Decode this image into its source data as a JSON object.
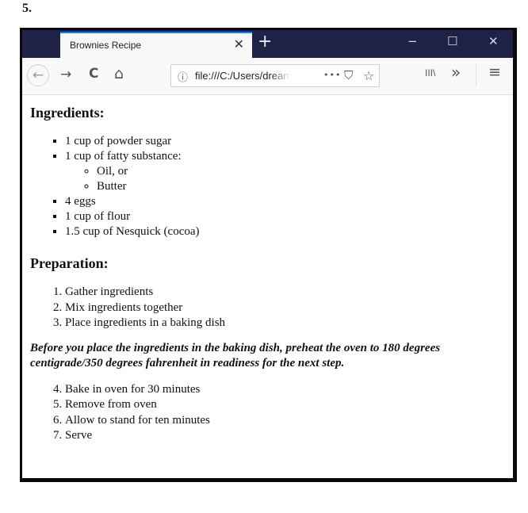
{
  "question_number": "5.",
  "browser": {
    "tab": {
      "title": "Brownies Recipe",
      "close_glyph": "✕"
    },
    "new_tab_glyph": "+",
    "window_controls": {
      "minimize": "−",
      "maximize": "☐",
      "close": "✕"
    },
    "toolbar": {
      "back_glyph": "←",
      "forward_glyph": "→",
      "reload_glyph": "C",
      "home_glyph": "⌂",
      "info_glyph": "ⓘ",
      "url": "file:///C:/Users/dream",
      "more_glyph": "•••",
      "pocket_glyph": "⛉",
      "star_glyph": "☆",
      "library_glyph": "III\\",
      "overflow_glyph": "»",
      "menu_glyph": "≡"
    }
  },
  "page": {
    "ingredients_heading": "Ingredients:",
    "ingredients": [
      "1 cup of powder sugar",
      "1 cup of fatty substance:",
      "4 eggs",
      "1 cup of flour",
      "1.5 cup of Nesquick (cocoa)"
    ],
    "fatty_options": [
      "Oil, or",
      "Butter"
    ],
    "preparation_heading": "Preparation:",
    "steps_part1": [
      "Gather ingredients",
      "Mix ingredients together",
      "Place ingredients in a baking dish"
    ],
    "note": "Before you place the ingredients in the baking dish, preheat the oven to 180 degrees centigrade/350 degrees fahrenheit in readiness for the next step.",
    "steps_part2": [
      "Bake in oven for 30 minutes",
      "Remove from oven",
      "Allow to stand for ten minutes",
      "Serve"
    ]
  }
}
